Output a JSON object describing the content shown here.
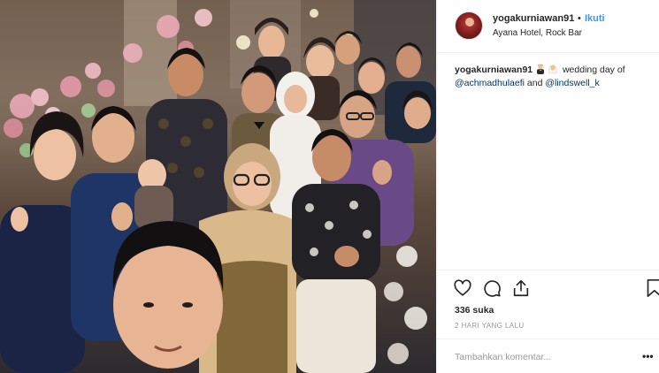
{
  "post": {
    "username": "yogakurniawan91",
    "separator": "•",
    "follow_label": "Ikuti",
    "location": "Ayana Hotel, Rock Bar",
    "caption": {
      "username": "yogakurniawan91",
      "text": "wedding day of",
      "mention_1": "@achmadhulaefi",
      "conjunction": "and",
      "mention_2": "@lindswell_k",
      "emoji_1": "person-in-tuxedo-emoji",
      "emoji_2": "bride-with-veil-emoji"
    },
    "likes": "336 suka",
    "timestamp": "2 HARI YANG LALU",
    "comment_placeholder": "Tambahkan komentar...",
    "more_label": "•••"
  },
  "icons": {
    "like": "heart-icon",
    "comment": "comment-icon",
    "share": "share-icon",
    "save": "bookmark-icon"
  },
  "colors": {
    "follow": "#3897f0",
    "mention": "#003569",
    "muted": "#999999"
  }
}
